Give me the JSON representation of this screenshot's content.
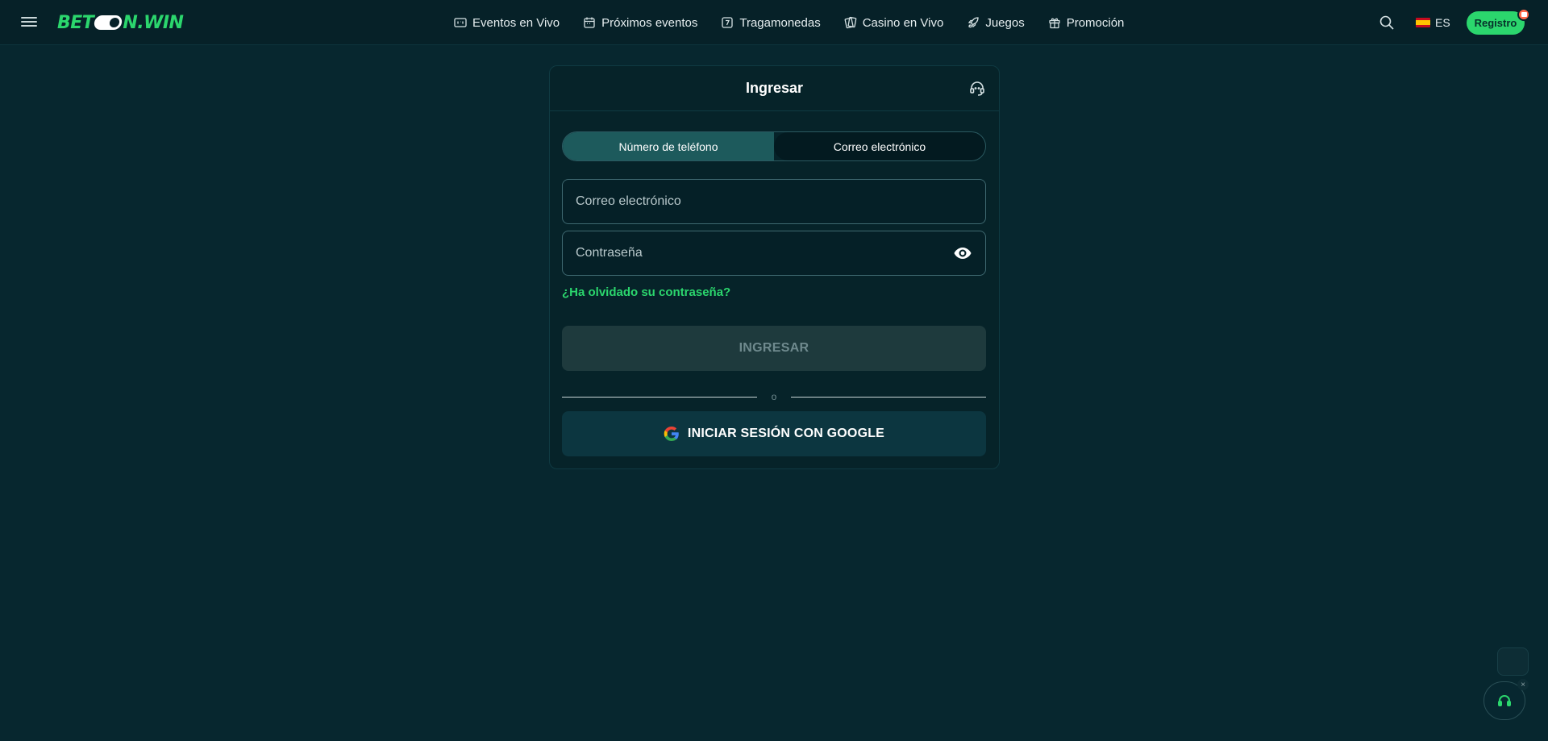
{
  "header": {
    "logo_left": "BET",
    "logo_right": "N.WIN",
    "nav": [
      {
        "label": "Eventos en Vivo",
        "icon": "live-events-icon"
      },
      {
        "label": "Próximos eventos",
        "icon": "calendar-icon"
      },
      {
        "label": "Tragamonedas",
        "icon": "slot-machine-icon"
      },
      {
        "label": "Casino en Vivo",
        "icon": "cards-icon"
      },
      {
        "label": "Juegos",
        "icon": "rocket-icon"
      },
      {
        "label": "Promoción",
        "icon": "gift-icon"
      }
    ],
    "language": "ES",
    "register_label": "Registro"
  },
  "login": {
    "title": "Ingresar",
    "tabs": [
      {
        "label": "Número de teléfono",
        "active": true
      },
      {
        "label": "Correo electrónico",
        "active": false
      }
    ],
    "email_placeholder": "Correo electrónico",
    "password_placeholder": "Contraseña",
    "forgot_label": "¿Ha olvidado su contraseña?",
    "submit_label": "INGRESAR",
    "divider_label": "o",
    "google_label": "INICIAR SESIÓN CON GOOGLE"
  },
  "colors": {
    "background": "#07272f",
    "accent": "#2bd66d",
    "panel": "#062329"
  }
}
